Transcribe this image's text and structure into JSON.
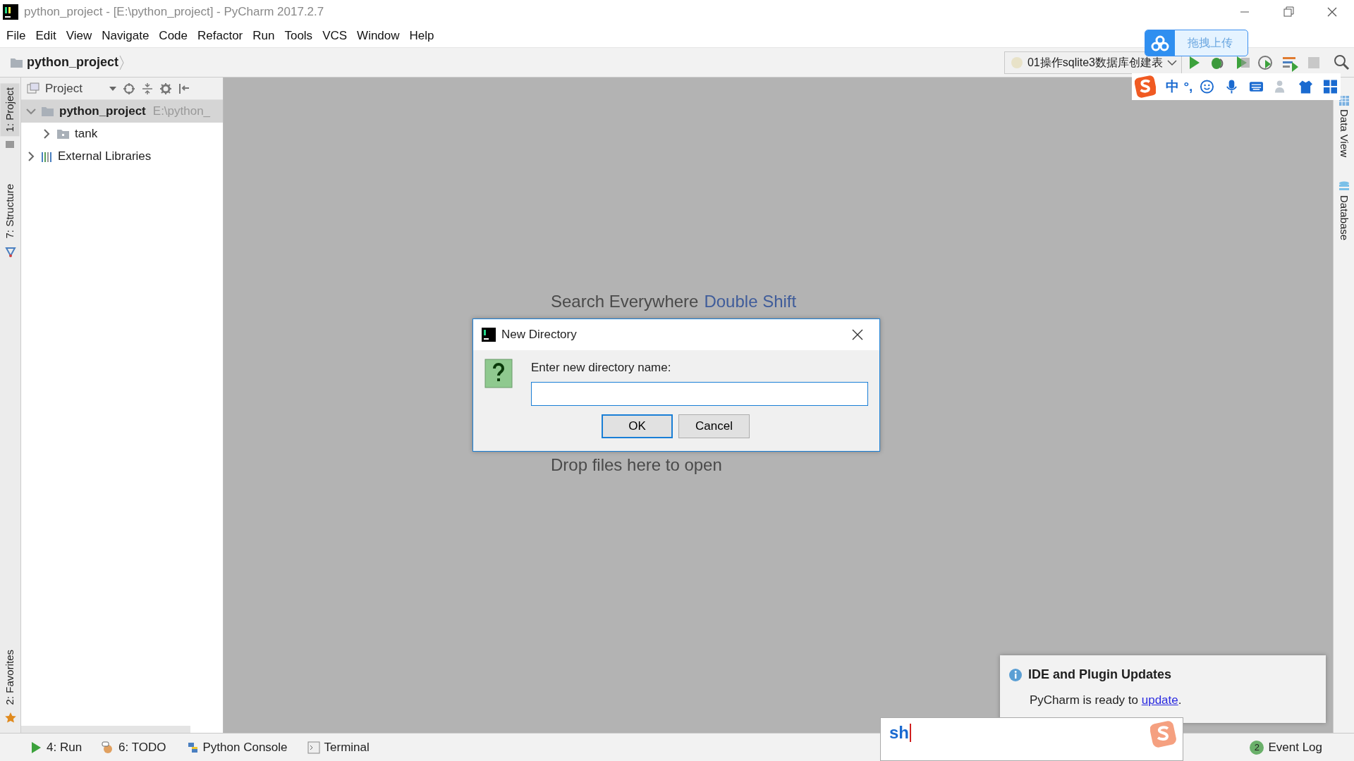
{
  "window": {
    "title": "python_project - [E:\\python_project] - PyCharm 2017.2.7"
  },
  "menu": [
    "File",
    "Edit",
    "View",
    "Navigate",
    "Code",
    "Refactor",
    "Run",
    "Tools",
    "VCS",
    "Window",
    "Help"
  ],
  "breadcrumb": "python_project",
  "run_config": "01操作sqlite3数据库创建表",
  "upload_widget": {
    "label": "拖拽上传"
  },
  "ime_toolbar": {
    "mode": "中",
    "punctuation": "°,"
  },
  "left_tabs": [
    {
      "label": "1: Project",
      "selected": true
    },
    {
      "label": "7: Structure",
      "selected": false
    },
    {
      "label": "2: Favorites",
      "selected": false
    }
  ],
  "project_panel": {
    "header": "Project",
    "tree": [
      {
        "label": "python_project",
        "path": "E:\\python_",
        "expanded": true,
        "selected": true,
        "children": [
          {
            "label": "tank",
            "expanded": false,
            "selected": false
          }
        ]
      },
      {
        "label": "External Libraries",
        "expanded": false,
        "selected": false
      }
    ]
  },
  "editor_hints": {
    "search": "Search Everywhere",
    "shortcut": "Double Shift",
    "drop": "Drop files here to open"
  },
  "dialog": {
    "title": "New Directory",
    "prompt": "Enter new directory name:",
    "buttons": [
      {
        "label": "OK",
        "default": true
      },
      {
        "label": "Cancel",
        "default": false
      }
    ]
  },
  "notification": {
    "title": "IDE and Plugin Updates",
    "message": "PyCharm is ready to",
    "link": "update",
    "after": "."
  },
  "right_tabs": [
    "Data View",
    "Database"
  ],
  "bottom_tools": [
    "4: Run",
    "6: TODO",
    "Python Console",
    "Terminal"
  ],
  "event_log": {
    "count": "2",
    "label": "Event Log"
  },
  "ime_input": "sh"
}
